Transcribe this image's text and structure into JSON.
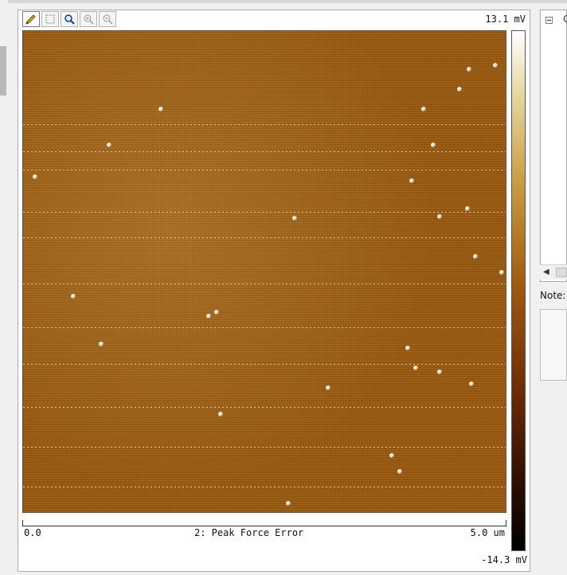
{
  "toolbar": {
    "tools": [
      {
        "icon": "pencil-icon",
        "glyph": "✎"
      },
      {
        "icon": "select-area-icon",
        "glyph": "⋯"
      },
      {
        "icon": "magnifier-icon",
        "glyph": "🔍"
      },
      {
        "icon": "zoom-in-icon",
        "glyph": "+"
      },
      {
        "icon": "zoom-out-icon",
        "glyph": "−"
      }
    ]
  },
  "image_view": {
    "scale_max": "13.1 mV",
    "scale_min": "-14.3 mV",
    "x_start": "0.0",
    "x_end": "5.0 um",
    "channel_label": "2: Peak Force Error"
  },
  "side_panel": {
    "tree_item": "C",
    "note_label": "Note:"
  },
  "colors": {
    "image_base": "#9a5a12",
    "colorbar_top": "#ffffff",
    "colorbar_bottom": "#000000"
  }
}
